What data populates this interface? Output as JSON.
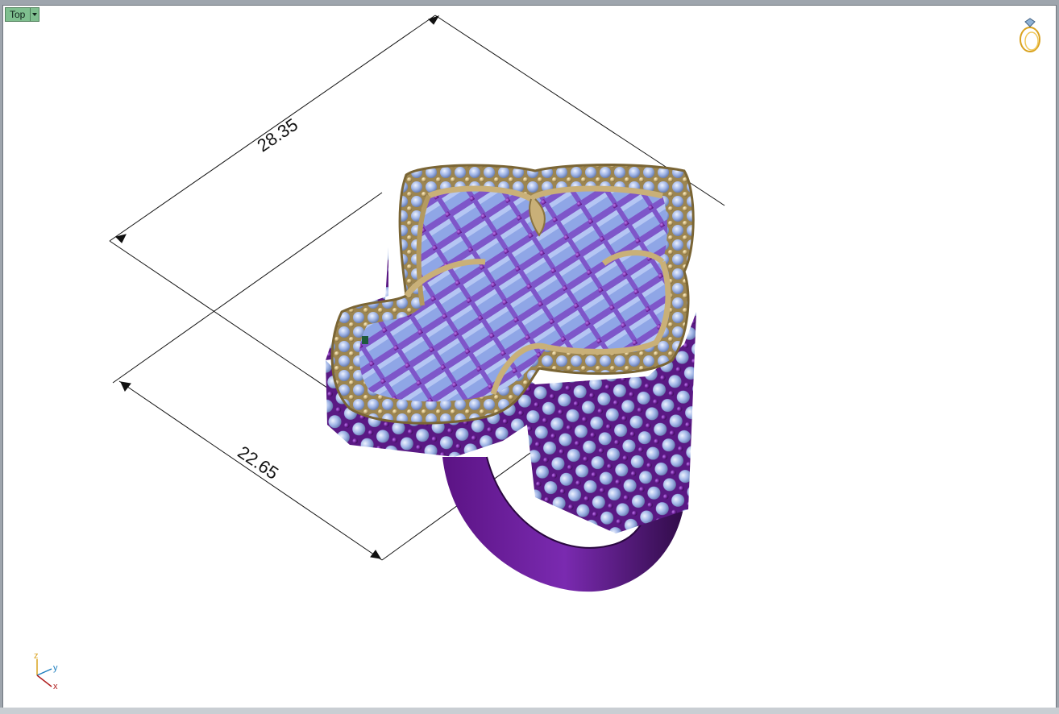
{
  "viewport": {
    "name": "Top",
    "dimensions": [
      "28.35",
      "22.65"
    ],
    "axes": [
      "z",
      "y",
      "x"
    ]
  },
  "colors": {
    "metal_purple": "#6a1e96",
    "metal_gold": "#c9b078",
    "stone_blue": "#9fb4e6",
    "accent_green": "#7fbf8f"
  },
  "icons": {
    "ring_badge": "ring-icon",
    "axis": "world-axis-icon"
  }
}
